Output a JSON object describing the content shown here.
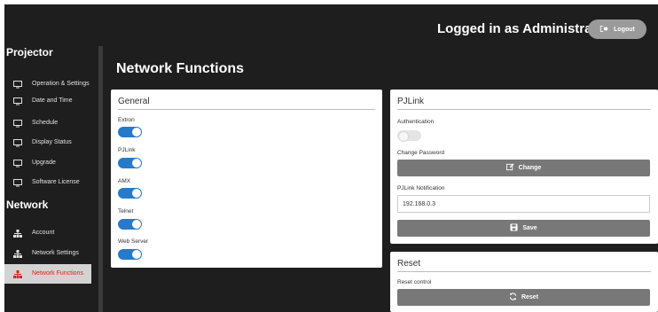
{
  "header": {
    "user_text": "Logged in as Administrator",
    "logout_label": "Logout"
  },
  "sidebar": {
    "projector_title": "Projector",
    "network_title": "Network",
    "projector_items": [
      {
        "label": "Operation & Settings",
        "icon": "monitor-icon"
      },
      {
        "label": "Date and Time",
        "icon": "monitor-icon"
      },
      {
        "label": "Schedule",
        "icon": "monitor-icon"
      },
      {
        "label": "Display Status",
        "icon": "monitor-icon"
      },
      {
        "label": "Upgrade",
        "icon": "monitor-icon"
      },
      {
        "label": "Software License",
        "icon": "monitor-icon"
      }
    ],
    "network_items": [
      {
        "label": "Account",
        "icon": "network-icon"
      },
      {
        "label": "Network Settings",
        "icon": "network-icon"
      },
      {
        "label": "Network Functions",
        "icon": "network-icon",
        "active": true
      }
    ]
  },
  "main": {
    "page_title": "Network Functions",
    "general": {
      "title": "General",
      "toggles": [
        {
          "label": "Extron",
          "on": true
        },
        {
          "label": "PJLink",
          "on": true
        },
        {
          "label": "AMX",
          "on": true
        },
        {
          "label": "Telnet",
          "on": true
        },
        {
          "label": "Web Server",
          "on": true
        }
      ]
    },
    "pjlink": {
      "title": "PJLink",
      "auth_label": "Authentication",
      "auth_on": false,
      "change_password_label": "Change Password",
      "change_button": "Change",
      "notification_label": "PJLink Notification",
      "notification_value": "192.168.0.3",
      "save_button": "Save"
    },
    "reset": {
      "title": "Reset",
      "control_label": "Reset control",
      "reset_button": "Reset"
    }
  },
  "colors": {
    "background": "#1e1e1e",
    "accent_toggle": "#2879c9",
    "active_nav_text": "#e0201b",
    "button_gray": "#787878"
  }
}
